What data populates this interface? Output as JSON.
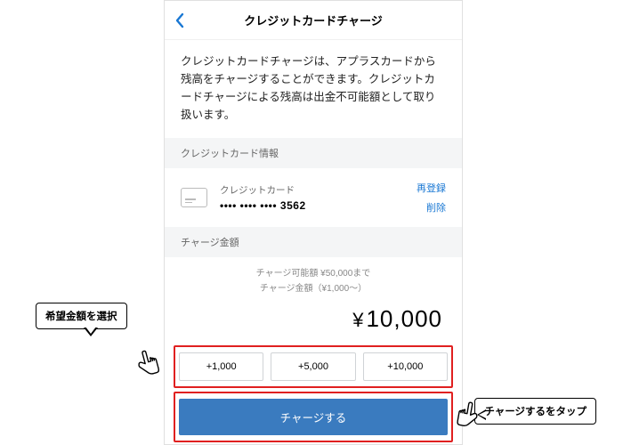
{
  "header": {
    "title": "クレジットカードチャージ"
  },
  "description": "クレジットカードチャージは、アプラスカードから残高をチャージすることができます。クレジットカードチャージによる残高は出金不可能額として取り扱います。",
  "card_section": {
    "header": "クレジットカード情報",
    "label": "クレジットカード",
    "masked_number": "•••• •••• •••• 3562",
    "reregister": "再登録",
    "delete": "削除"
  },
  "charge_section": {
    "header": "チャージ金額",
    "limit_text": "チャージ可能額 ¥50,000まで",
    "range_text": "チャージ金額（¥1,000〜）",
    "amount_value": "10,000",
    "presets": [
      "+1,000",
      "+5,000",
      "+10,000"
    ],
    "charge_button": "チャージする"
  },
  "callouts": {
    "select_amount": "希望金額を選択",
    "tap_charge": "チャージするをタップ"
  }
}
